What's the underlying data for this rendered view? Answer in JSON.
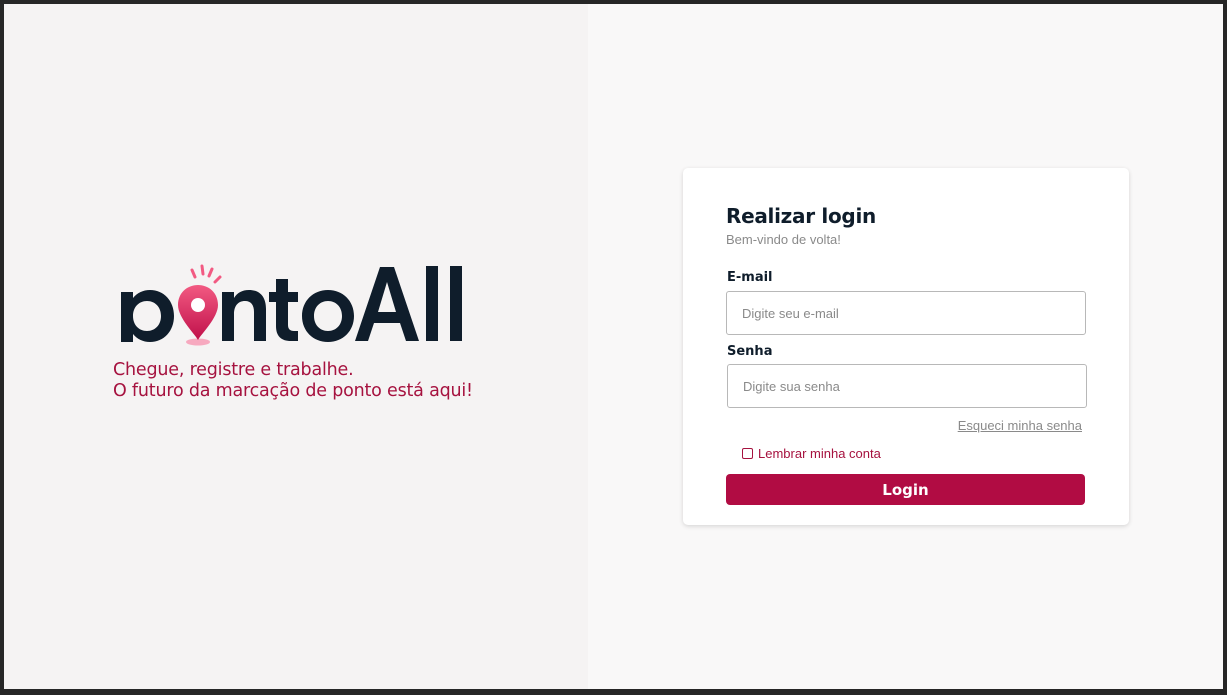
{
  "brand": {
    "logo_text": "pontoAll",
    "tagline_line1": "Chegue, registre e trabalhe.",
    "tagline_line2": "O futuro da marcação de ponto está aqui!",
    "logo_icon": "location-pin-icon"
  },
  "login": {
    "title": "Realizar login",
    "subtitle": "Bem-vindo de volta!",
    "email_label": "E-mail",
    "email_placeholder": "Digite seu e-mail",
    "email_value": "",
    "password_label": "Senha",
    "password_placeholder": "Digite sua senha",
    "password_value": "",
    "forgot_link": "Esqueci minha senha",
    "remember_label": "Lembrar minha conta",
    "remember_checked": false,
    "submit_label": "Login"
  },
  "colors": {
    "accent": "#b10c43",
    "text_dark": "#0f1d2b",
    "tagline": "#a6123f"
  }
}
